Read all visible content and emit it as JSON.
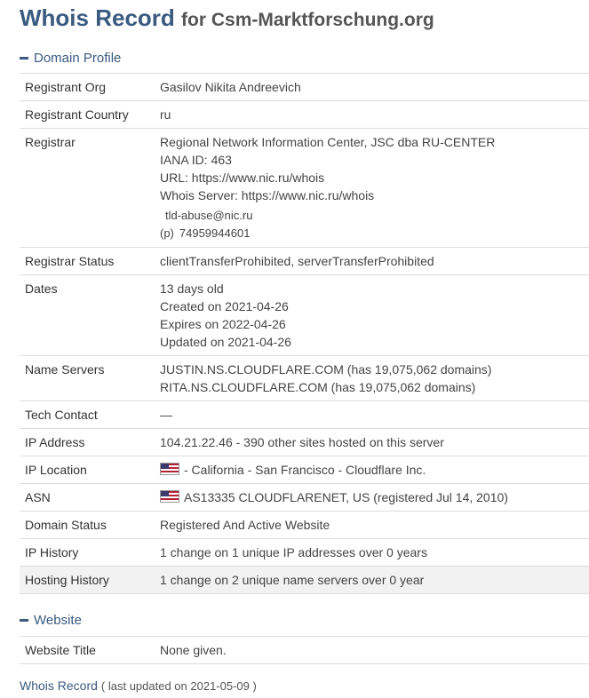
{
  "page": {
    "title_main": "Whois Record",
    "title_for": "for Csm-Marktforschung.org"
  },
  "domain_profile": {
    "heading": "Domain Profile",
    "registrant_org": {
      "label": "Registrant Org",
      "value": "Gasilov Nikita Andreevich"
    },
    "registrant_country": {
      "label": "Registrant Country",
      "value": "ru"
    },
    "registrar": {
      "label": "Registrar",
      "name": "Regional Network Information Center, JSC dba RU-CENTER",
      "iana": "IANA ID: 463",
      "url": "URL: https://www.nic.ru/whois",
      "whois_server": "Whois Server: https://www.nic.ru/whois",
      "email": "tld-abuse@nic.ru",
      "phone_label": "(p)",
      "phone": "74959944601"
    },
    "registrar_status": {
      "label": "Registrar Status",
      "value": "clientTransferProhibited, serverTransferProhibited"
    },
    "dates": {
      "label": "Dates",
      "age": "13 days old",
      "created": "Created on 2021-04-26",
      "expires": "Expires on 2022-04-26",
      "updated": "Updated on 2021-04-26"
    },
    "name_servers": {
      "label": "Name Servers",
      "ns1": "JUSTIN.NS.CLOUDFLARE.COM (has 19,075,062 domains)",
      "ns2": "RITA.NS.CLOUDFLARE.COM (has 19,075,062 domains)"
    },
    "tech_contact": {
      "label": "Tech Contact",
      "value": "—"
    },
    "ip_address": {
      "label": "IP Address",
      "value": "104.21.22.46 - 390 other sites hosted on this server"
    },
    "ip_location": {
      "label": "IP Location",
      "value": "- California - San Francisco - Cloudflare Inc.",
      "flag": "us-flag-icon"
    },
    "asn": {
      "label": "ASN",
      "value": "AS13335 CLOUDFLARENET, US (registered Jul 14, 2010)",
      "flag": "us-flag-icon"
    },
    "domain_status": {
      "label": "Domain Status",
      "value": "Registered And Active Website"
    },
    "ip_history": {
      "label": "IP History",
      "value": "1 change on 1 unique IP addresses over 0 years"
    },
    "hosting_history": {
      "label": "Hosting History",
      "value": "1 change on 2 unique name servers over 0 year"
    }
  },
  "website": {
    "heading": "Website",
    "website_title": {
      "label": "Website Title",
      "value": "None given."
    }
  },
  "footer": {
    "link": "Whois Record",
    "updated": "( last updated on 2021-05-09 )"
  },
  "colors": {
    "accent": "#3a5a80",
    "row_shade": "#f2f2f2",
    "border": "#dddddd"
  }
}
